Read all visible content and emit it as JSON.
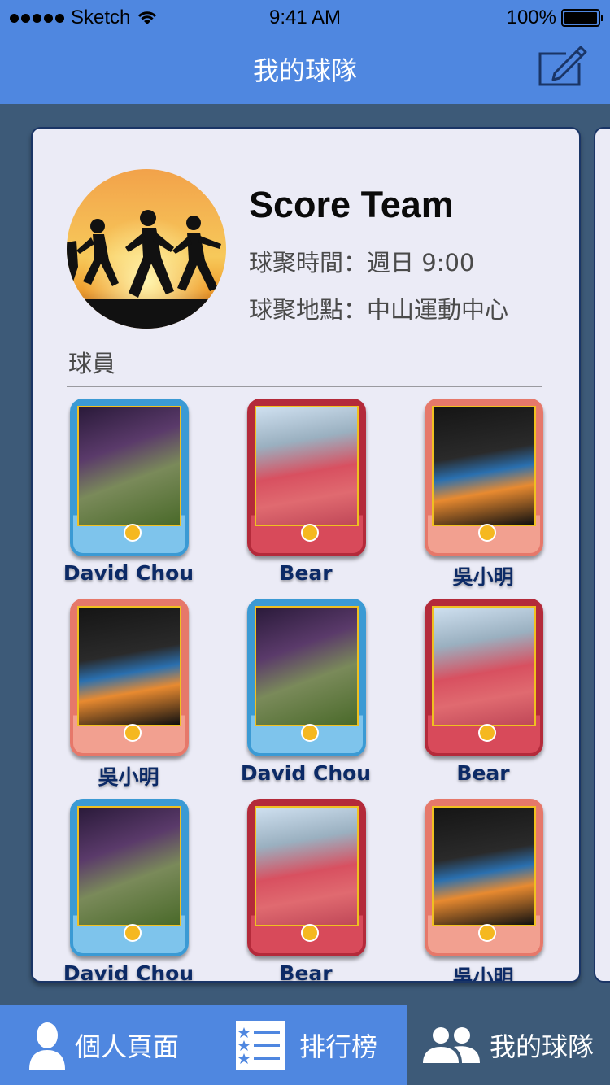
{
  "status_bar": {
    "carrier": "Sketch",
    "time": "9:41 AM",
    "battery": "100%"
  },
  "nav": {
    "title": "我的球隊",
    "edit_icon": "edit-square-icon"
  },
  "team": {
    "name": "Score Team",
    "time_text": "球聚時間：週日 9:00",
    "place_text": "球聚地點：中山運動中心",
    "members_label": "球員"
  },
  "members": [
    {
      "name": "David Chou",
      "frame": "blue"
    },
    {
      "name": "Bear",
      "frame": "red"
    },
    {
      "name": "吳小明",
      "frame": "orange"
    },
    {
      "name": "吳小明",
      "frame": "orange"
    },
    {
      "name": "David Chou",
      "frame": "blue"
    },
    {
      "name": "Bear",
      "frame": "red"
    },
    {
      "name": "David Chou",
      "frame": "blue"
    },
    {
      "name": "Bear",
      "frame": "red"
    },
    {
      "name": "吳小明",
      "frame": "orange"
    }
  ],
  "tabs": [
    {
      "label": "個人頁面",
      "icon": "person-icon",
      "active": false
    },
    {
      "label": "排行榜",
      "icon": "ranking-list-icon",
      "active": false
    },
    {
      "label": "我的球隊",
      "icon": "team-icon",
      "active": true
    }
  ],
  "colors": {
    "primary": "#4f87e0",
    "background": "#3d5a78",
    "card": "#ebebf6",
    "member_name": "#0c2a66"
  }
}
